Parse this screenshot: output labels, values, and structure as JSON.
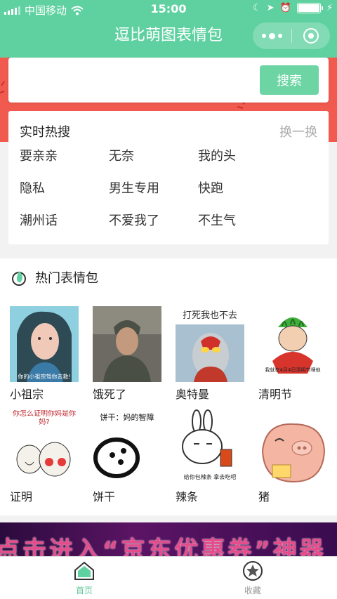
{
  "statusbar": {
    "carrier": "中国移动",
    "time": "15:00"
  },
  "nav": {
    "title": "逗比萌图表情包"
  },
  "search": {
    "placeholder": "",
    "button_label": "搜索"
  },
  "hot_search": {
    "title": "实时热搜",
    "refresh_label": "换一换",
    "items": [
      "要亲亲",
      "无奈",
      "我的头",
      "隐私",
      "男生专用",
      "快跑",
      "潮州话",
      "不爱我了",
      "不生气"
    ]
  },
  "popular": {
    "title": "热门表情包",
    "items": [
      {
        "label": "小祖宗",
        "caption": "你的小祖宗驾你去救!"
      },
      {
        "label": "饿死了",
        "caption": ""
      },
      {
        "label": "奥特曼",
        "caption": "打死我也不去"
      },
      {
        "label": "清明节",
        "caption": "我就在4月4日清明节埋他"
      },
      {
        "label": "证明",
        "caption": "你怎么证明你妈是你妈?"
      },
      {
        "label": "饼干",
        "caption": "饼干：妈的智障"
      },
      {
        "label": "辣条",
        "caption": "给你包辣条 拿去吃吧"
      },
      {
        "label": "猪",
        "caption": ""
      }
    ]
  },
  "ad": {
    "text": "点击进入“京东优惠券”神器"
  },
  "tabbar": {
    "tabs": [
      {
        "label": "首页",
        "icon": "home-icon",
        "active": true
      },
      {
        "label": "收藏",
        "icon": "star-icon",
        "active": false
      }
    ]
  },
  "colors": {
    "accent": "#5fd1a0",
    "banner_red": "#f15a4f",
    "search_button": "#6dd5a4"
  }
}
